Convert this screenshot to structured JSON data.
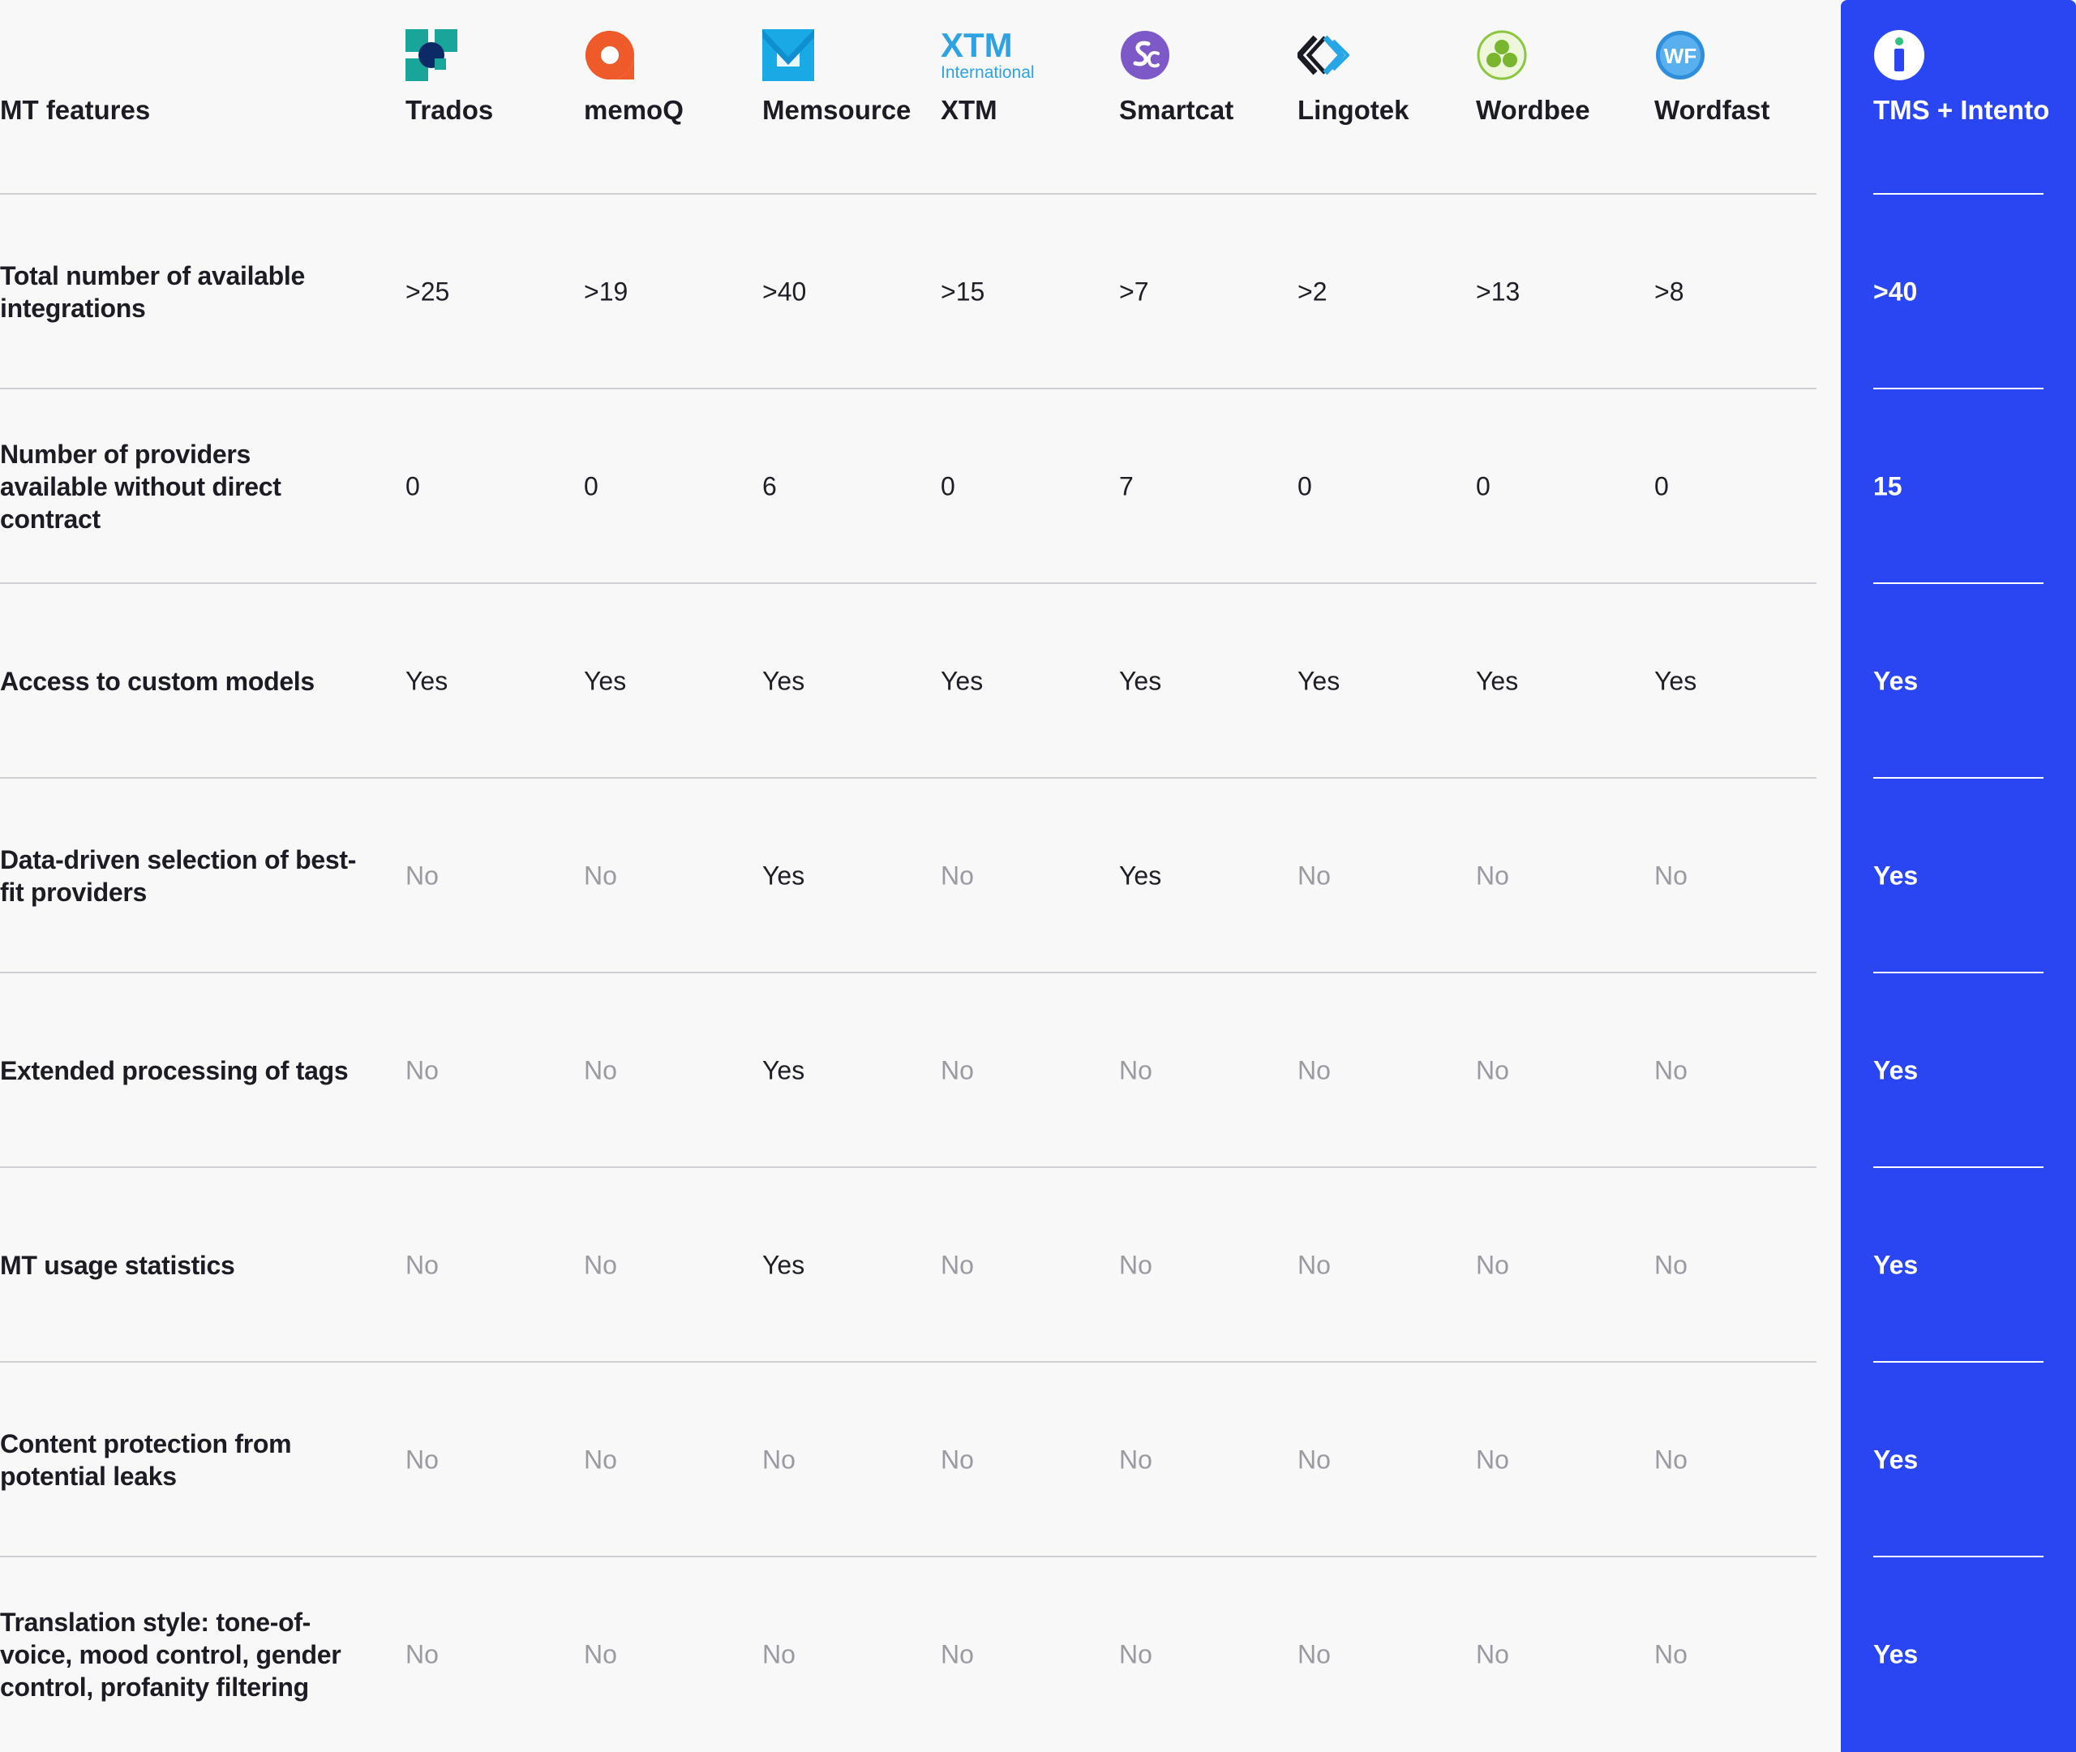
{
  "header": {
    "feature_column": "MT features",
    "vendors": [
      {
        "name": "Trados",
        "icon": "trados-logo-icon"
      },
      {
        "name": "memoQ",
        "icon": "memoq-logo-icon"
      },
      {
        "name": "Memsource",
        "icon": "memsource-logo-icon"
      },
      {
        "name": "XTM",
        "icon": "xtm-international-logo-icon",
        "logo_text_top": "XTM",
        "logo_text_bottom": "International"
      },
      {
        "name": "Smartcat",
        "icon": "smartcat-logo-icon"
      },
      {
        "name": "Lingotek",
        "icon": "lingotek-logo-icon"
      },
      {
        "name": "Wordbee",
        "icon": "wordbee-logo-icon"
      },
      {
        "name": "Wordfast",
        "icon": "wordfast-logo-icon",
        "logo_text": "WF"
      }
    ],
    "highlight": {
      "name": "TMS + Intento",
      "icon": "intento-logo-icon"
    }
  },
  "rows": [
    {
      "feature": "Total number of available integrations",
      "values": [
        ">25",
        ">19",
        ">40",
        ">15",
        ">7",
        ">2",
        ">13",
        ">8"
      ],
      "highlight": ">40"
    },
    {
      "feature": "Number of providers available without direct contract",
      "values": [
        "0",
        "0",
        "6",
        "0",
        "7",
        "0",
        "0",
        "0"
      ],
      "highlight": "15"
    },
    {
      "feature": "Access to custom models",
      "values": [
        "Yes",
        "Yes",
        "Yes",
        "Yes",
        "Yes",
        "Yes",
        "Yes",
        "Yes"
      ],
      "highlight": "Yes"
    },
    {
      "feature": "Data-driven selection of best-fit providers",
      "values": [
        "No",
        "No",
        "Yes",
        "No",
        "Yes",
        "No",
        "No",
        "No"
      ],
      "highlight": "Yes"
    },
    {
      "feature": "Extended processing of tags",
      "values": [
        "No",
        "No",
        "Yes",
        "No",
        "No",
        "No",
        "No",
        "No"
      ],
      "highlight": "Yes"
    },
    {
      "feature": "MT usage statistics",
      "values": [
        "No",
        "No",
        "Yes",
        "No",
        "No",
        "No",
        "No",
        "No"
      ],
      "highlight": "Yes"
    },
    {
      "feature": "Content protection from potential leaks",
      "values": [
        "No",
        "No",
        "No",
        "No",
        "No",
        "No",
        "No",
        "No"
      ],
      "highlight": "Yes"
    },
    {
      "feature": "Translation style: tone-of-voice, mood control, gender control, profanity filtering",
      "values": [
        "No",
        "No",
        "No",
        "No",
        "No",
        "No",
        "No",
        "No"
      ],
      "highlight": "Yes"
    }
  ],
  "colors": {
    "background": "#f8f8f8",
    "highlight_column": "#2a46f2",
    "no_text": "#9a9aa2",
    "text": "#1c1c24"
  }
}
